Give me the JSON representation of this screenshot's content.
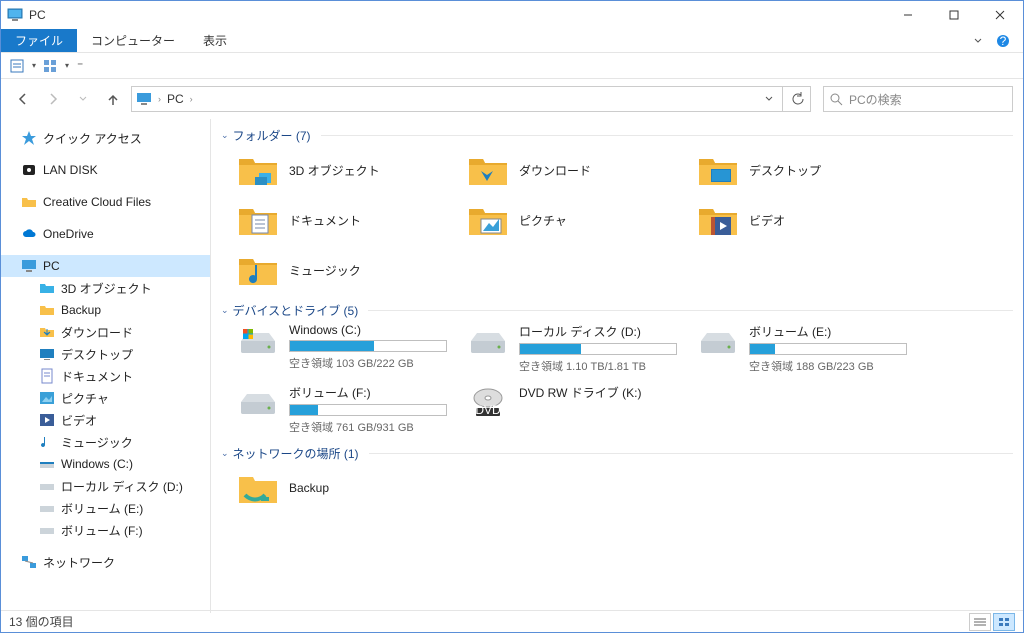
{
  "window": {
    "title": "PC"
  },
  "menu": {
    "file": "ファイル",
    "computer": "コンピューター",
    "view": "表示"
  },
  "address": {
    "root": "PC"
  },
  "search": {
    "placeholder": "PCの検索"
  },
  "sidebar": {
    "quickaccess": "クイック アクセス",
    "landisk": "LAN DISK",
    "ccfiles": "Creative Cloud Files",
    "onedrive": "OneDrive",
    "pc": "PC",
    "items": [
      "3D オブジェクト",
      "Backup",
      "ダウンロード",
      "デスクトップ",
      "ドキュメント",
      "ピクチャ",
      "ビデオ",
      "ミュージック",
      "Windows (C:)",
      "ローカル ディスク (D:)",
      "ボリューム (E:)",
      "ボリューム (F:)"
    ],
    "network": "ネットワーク"
  },
  "sections": {
    "folders": {
      "title": "フォルダー (7)",
      "items": [
        "3D オブジェクト",
        "ダウンロード",
        "デスクトップ",
        "ドキュメント",
        "ピクチャ",
        "ビデオ",
        "ミュージック"
      ]
    },
    "drives": {
      "title": "デバイスとドライブ (5)",
      "items": [
        {
          "name": "Windows (C:)",
          "free": "空き領域 103 GB/222 GB",
          "pct": 54
        },
        {
          "name": "ローカル ディスク (D:)",
          "free": "空き領域 1.10 TB/1.81 TB",
          "pct": 39
        },
        {
          "name": "ボリューム (E:)",
          "free": "空き領域 188 GB/223 GB",
          "pct": 16
        },
        {
          "name": "ボリューム (F:)",
          "free": "空き領域 761 GB/931 GB",
          "pct": 18
        },
        {
          "name": "DVD RW ドライブ (K:)",
          "free": "",
          "pct": -1
        }
      ]
    },
    "network": {
      "title": "ネットワークの場所 (1)",
      "items": [
        "Backup"
      ]
    }
  },
  "status": {
    "count": "13 個の項目"
  }
}
